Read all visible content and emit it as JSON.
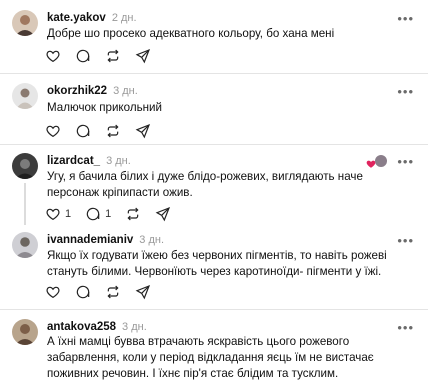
{
  "posts": [
    {
      "username": "kate.yakov",
      "time": "2 дн.",
      "text": "Добре шо просеко адекватного кольору, бо хана мені",
      "likes": "",
      "replies": ""
    },
    {
      "username": "okorzhik22",
      "time": "3 дн.",
      "text": "Малючок прикольний",
      "likes": "",
      "replies": ""
    },
    {
      "username": "lizardcat_",
      "time": "3 дн.",
      "text": "Угу, я бачила білих і дуже блідо-рожевих, виглядають наче персонаж кріпипасти ожив.",
      "likes": "1",
      "replies": "1"
    },
    {
      "username": "ivannademianiv",
      "time": "3 дн.",
      "text": "Якщо їх годувати їжею без червоних пігментів, то навіть рожеві стануть білими. Червонїють через каротиноїди- пігменти у їжі.",
      "likes": "",
      "replies": ""
    },
    {
      "username": "antakova258",
      "time": "3 дн.",
      "text": "А їхні мамці бувва втрачають яскравість цього рожевого забарвлення, коли у період відкладання яєць їм не вистачає поживних речовин. І їхнє пір'я стає блідим та тусклим.",
      "likes": "",
      "replies": ""
    }
  ],
  "icons": {
    "more": "more-horizontal-icon",
    "like": "heart-icon",
    "reply": "comment-icon",
    "repost": "repost-icon",
    "share": "share-icon"
  },
  "colors": {
    "text": "#101010",
    "muted": "#999999",
    "divider": "#e4e4e4",
    "accent_heart": "#e0245e"
  }
}
